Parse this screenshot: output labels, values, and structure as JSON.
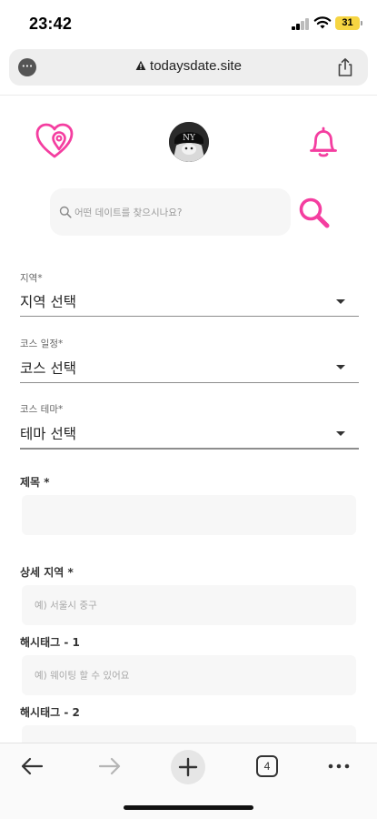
{
  "status_bar": {
    "time": "23:42",
    "battery": "31"
  },
  "browser": {
    "url": "todaysdate.site",
    "tab_count": "4"
  },
  "search": {
    "placeholder": "어떤 데이트를 찾으시나요?"
  },
  "form": {
    "region": {
      "label": "지역*",
      "value": "지역 선택"
    },
    "schedule": {
      "label": "코스 일정*",
      "value": "코스 선택"
    },
    "theme": {
      "label": "코스 테마*",
      "value": "테마 선택"
    },
    "title": {
      "label": "제목 *",
      "value": ""
    },
    "detail_region": {
      "label": "상세 지역 *",
      "placeholder": "예) 서울시 중구"
    },
    "hashtag1": {
      "label": "해시태그 - 1",
      "placeholder": "예) 웨이팅 할 수 있어요"
    },
    "hashtag2": {
      "label": "해시태그 - 2"
    }
  },
  "colors": {
    "accent": "#f43ea0",
    "background": "#ffffff",
    "input_bg": "#f7f7f7"
  },
  "icons": [
    "signal-icon",
    "wifi-icon",
    "warning-icon",
    "share-icon",
    "pin-heart-icon",
    "bell-icon",
    "search-icon",
    "back-icon",
    "forward-icon",
    "plus-icon",
    "tabs-icon",
    "more-icon"
  ]
}
